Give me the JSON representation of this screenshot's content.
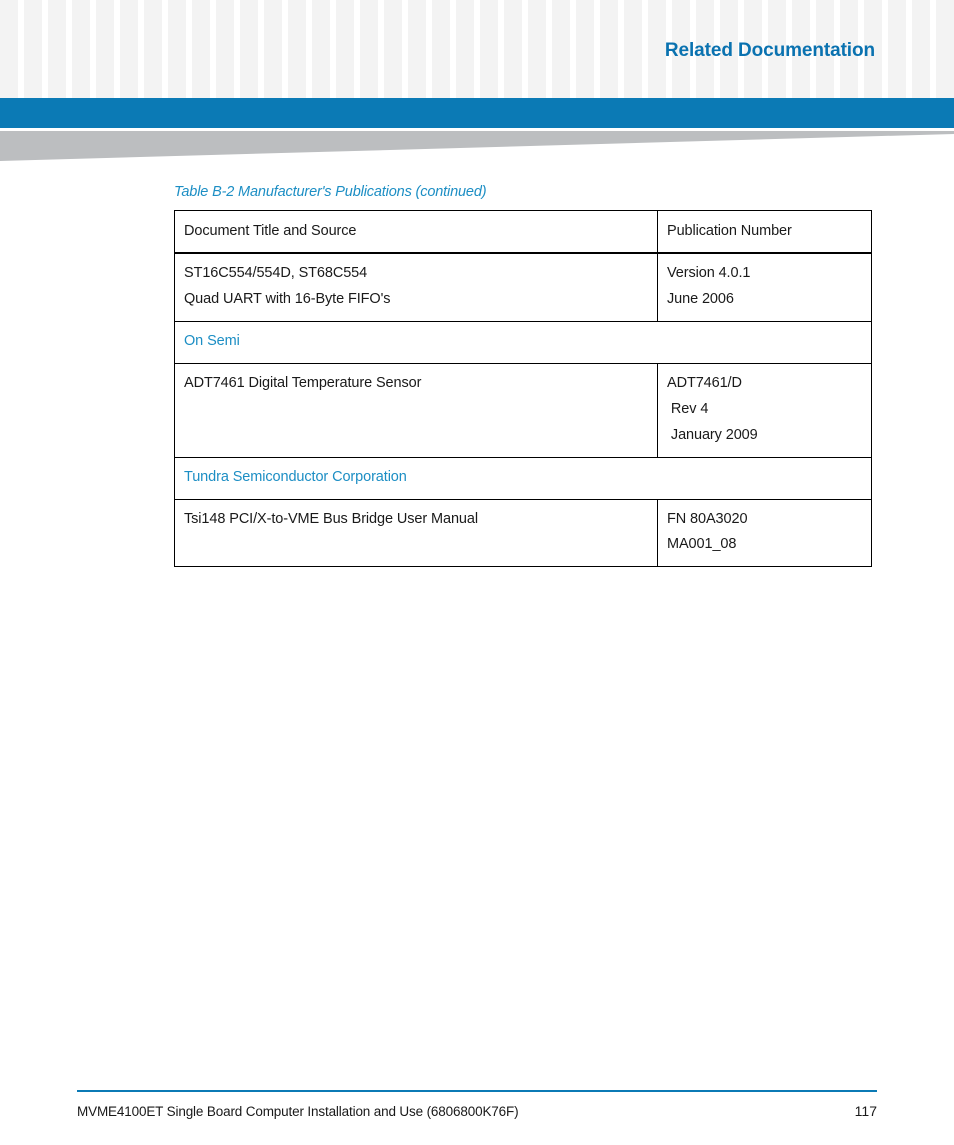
{
  "header": {
    "title": "Related Documentation",
    "band_color": "#0b7ab5",
    "title_color": "#0a72b0",
    "swoosh_color": "#bcbec0"
  },
  "table_caption": "Table B-2 Manufacturer's Publications (continued)",
  "table": {
    "accent_color": "#1c8ec4",
    "columns": [
      "Document Title and Source",
      "Publication Number"
    ],
    "rows": [
      {
        "kind": "data",
        "title_lines": [
          "ST16C554/554D, ST68C554",
          "Quad UART with 16-Byte FIFO's"
        ],
        "number_lines": [
          "Version 4.0.1",
          "June 2006"
        ]
      },
      {
        "kind": "section",
        "label": "On Semi"
      },
      {
        "kind": "data",
        "title_lines": [
          "ADT7461 Digital Temperature Sensor"
        ],
        "number_lines": [
          "ADT7461/D",
          " Rev 4",
          " January 2009"
        ]
      },
      {
        "kind": "section",
        "label": "Tundra Semiconductor Corporation"
      },
      {
        "kind": "data",
        "title_lines": [
          "Tsi148 PCI/X-to-VME Bus Bridge User Manual"
        ],
        "number_lines": [
          "FN 80A3020",
          "MA001_08"
        ]
      }
    ]
  },
  "footer": {
    "text": "MVME4100ET Single Board Computer Installation and Use (6806800K76F)",
    "page_number": "117",
    "rule_color": "#0b7ab5"
  }
}
